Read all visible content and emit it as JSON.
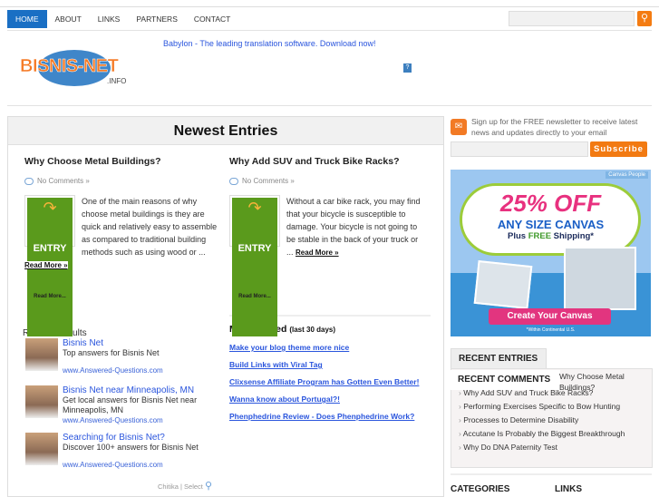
{
  "nav": {
    "items": [
      "HOME",
      "ABOUT",
      "LINKS",
      "PARTNERS",
      "CONTACT"
    ],
    "search_placeholder": ""
  },
  "header": {
    "logo_text": "BISNIS-NET",
    "logo_suffix": ".INFO",
    "ad_link": "Babylon - The leading translation software. Download now!",
    "help_icon": "?"
  },
  "main": {
    "title": "Newest Entries",
    "posts": [
      {
        "title": "Why Choose Metal Buildings?",
        "comments": "No Comments »",
        "thumb_label": "ENTRY",
        "thumb_sub": "Read More...",
        "excerpt": "One of the main reasons of why choose metal buildings is they are quick and relatively easy to assemble as compared to traditional building methods such as using wood or ... ",
        "read_more": "Read More »"
      },
      {
        "title": "Why Add SUV and Truck Bike Racks?",
        "comments": "No Comments »",
        "thumb_label": "ENTRY",
        "thumb_sub": "Read More...",
        "excerpt": "Without a car bike rack, you may find that your bicycle is susceptible to damage. Your bicycle is not going to be stable in the back of your truck or ... ",
        "read_more": "Read More »"
      }
    ],
    "related": {
      "heading": "Related Results",
      "items": [
        {
          "title": "Bisnis Net",
          "desc": "Top answers for Bisnis Net",
          "url": "www.Answered-Questions.com"
        },
        {
          "title": "Bisnis Net near Minneapolis, MN",
          "desc": "Get local answers for Bisnis Net near Minneapolis, MN",
          "url": "www.Answered-Questions.com"
        },
        {
          "title": "Searching for Bisnis Net?",
          "desc": "Discover 100+ answers for Bisnis Net",
          "url": "www.Answered-Questions.com"
        }
      ],
      "footer": "Chitika | Select"
    },
    "most_viewed": {
      "title": "Most Viewed",
      "subtitle": "(last 30 days)",
      "links": [
        "Make your blog theme more nice",
        "Build Links with Viral Tag",
        "Clixsense Affiliate Program has Gotten Even Better!",
        "Wanna know about Portugal?!",
        "Phenphedrine Review - Does Phenphedrine Work?"
      ]
    }
  },
  "sidebar": {
    "newsletter": {
      "text": "Sign up for the FREE newsletter to receive latest news and updates directly to your email",
      "button": "Subscribe"
    },
    "ad": {
      "brand": "Canvas People",
      "headline": "25% OFF",
      "line2": "ANY SIZE CANVAS",
      "line3a": "Plus ",
      "line3b": "FREE",
      "line3c": " Shipping*",
      "cta": "Create Your Canvas",
      "fine": "*Within Continental U.S."
    },
    "tabs": {
      "recent_entries": "RECENT ENTRIES",
      "recent_comments": "RECENT COMMENTS",
      "items": [
        "Why Choose Metal Buildings?",
        "Why Add SUV and Truck Bike Racks?",
        "Performing Exercises Specific to Bow Hunting",
        "Processes to Determine Disability",
        "Accutane Is Probably the Biggest Breakthrough",
        "Why Do DNA Paternity Test"
      ]
    },
    "categories": "CATEGORIES",
    "links": "LINKS"
  }
}
